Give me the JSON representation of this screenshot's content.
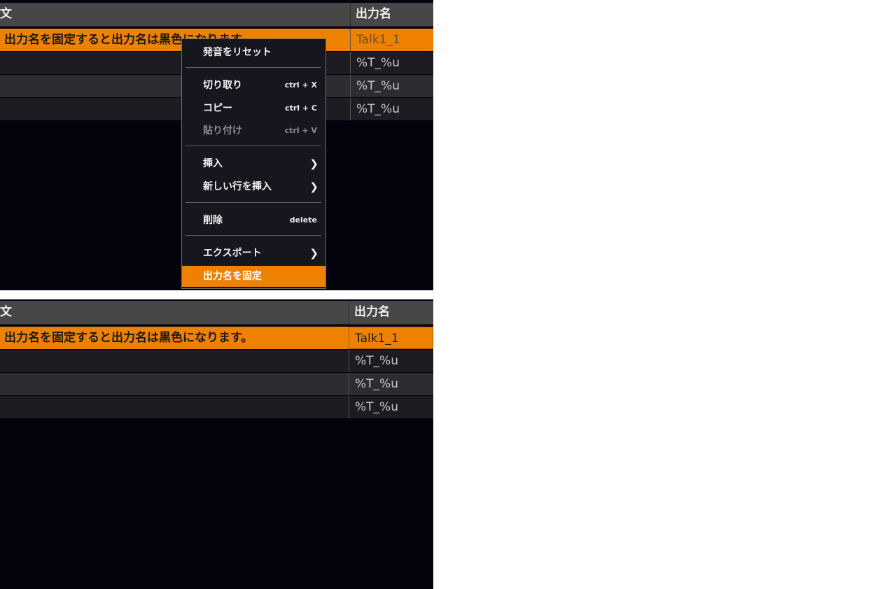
{
  "table": {
    "col_text": "文",
    "col_out": "出力名"
  },
  "top_rows": [
    {
      "text": "出力名を固定すると出力名は黒色になります。",
      "out": "Talk1_1"
    },
    {
      "text": "",
      "out": "%T_%u"
    },
    {
      "text": "",
      "out": "%T_%u"
    },
    {
      "text": "",
      "out": "%T_%u"
    }
  ],
  "bottom_rows": [
    {
      "text": "出力名を固定すると出力名は黒色になります。",
      "out": "Talk1_1"
    },
    {
      "text": "",
      "out": "%T_%u"
    },
    {
      "text": "",
      "out": "%T_%u"
    },
    {
      "text": "",
      "out": "%T_%u"
    }
  ],
  "context_menu": {
    "reset_pronunciation": "発音をリセット",
    "cut": "切り取り",
    "cut_shortcut": "ctrl + X",
    "copy": "コピー",
    "copy_shortcut": "ctrl + C",
    "paste": "貼り付け",
    "paste_shortcut": "ctrl + V",
    "insert": "挿入",
    "insert_new_row": "新しい行を挿入",
    "delete": "削除",
    "delete_shortcut": "delete",
    "export": "エクスポート",
    "fix_output_name": "出力名を固定"
  },
  "colors": {
    "accent": "#ef8100",
    "background": "#03030d",
    "header": "#474747"
  }
}
